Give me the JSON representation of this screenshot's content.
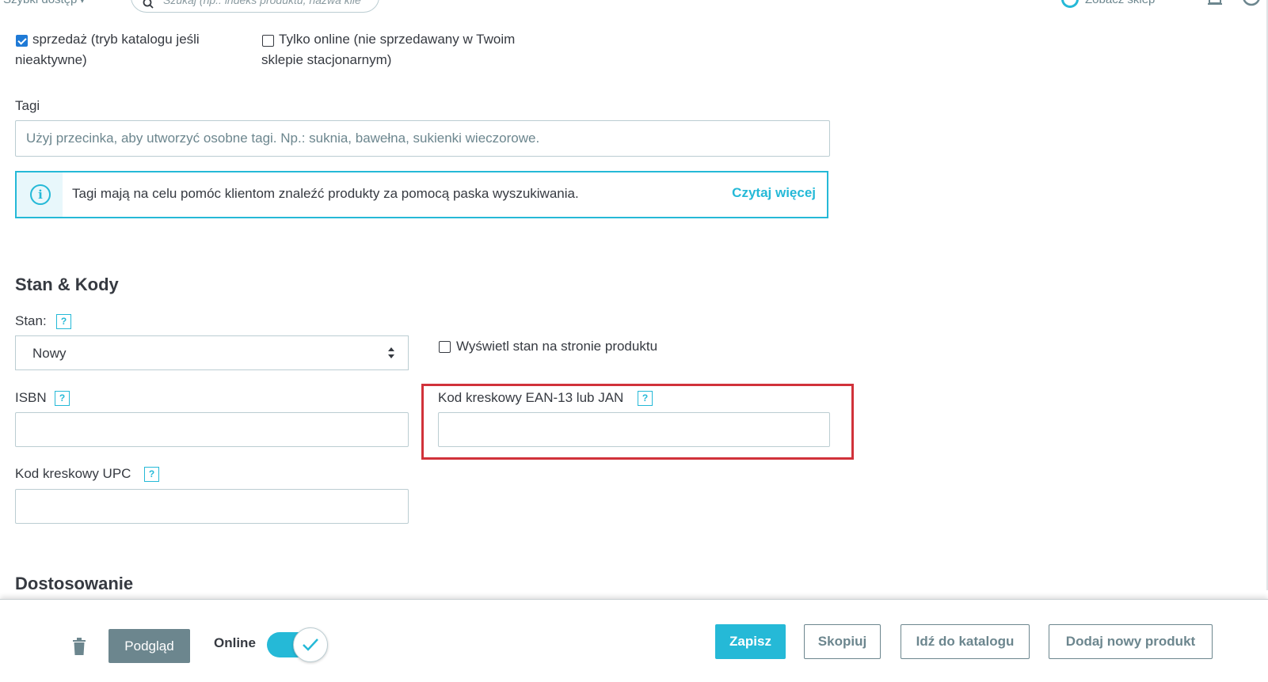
{
  "topbar": {
    "quick_access": "Szybki dostęp",
    "search_placeholder": "Szukaj (np.: indeks produktu, nazwa klie",
    "view_shop": "Zobacz sklep"
  },
  "options": {
    "sale_label_line1": "sprzedaż (tryb katalogu jeśli",
    "sale_label_line2": "nieaktywne)",
    "sale_checked": true,
    "online_only_line1": "Tylko online (nie sprzedawany w Twoim",
    "online_only_line2": "sklepie stacjonarnym)",
    "online_only_checked": false
  },
  "tags": {
    "label": "Tagi",
    "placeholder": "Użyj przecinka, aby utworzyć osobne tagi. Np.: suknia, bawełna, sukienki wieczorowe.",
    "info_text": "Tagi mają na celu pomóc klientom znaleźć produkty za pomocą paska wyszukiwania.",
    "info_link": "Czytaj więcej"
  },
  "stock_codes": {
    "title": "Stan & Kody",
    "condition_label": "Stan:",
    "condition_value": "Nowy",
    "show_condition_label": "Wyświetl stan na stronie produktu",
    "show_condition_checked": false,
    "isbn_label": "ISBN",
    "isbn_value": "",
    "ean_label": "Kod kreskowy EAN-13 lub JAN",
    "ean_value": "",
    "upc_label": "Kod kreskowy UPC",
    "upc_value": "",
    "help_glyph": "?"
  },
  "customization": {
    "title": "Dostosowanie"
  },
  "footer": {
    "preview": "Podgląd",
    "online_label": "Online",
    "online_enabled": true,
    "save": "Zapisz",
    "duplicate": "Skopiuj",
    "go_to_catalog": "Idź do katalogu",
    "add_new_product": "Dodaj nowy produkt"
  },
  "colors": {
    "accent": "#25b9d7",
    "highlight": "#d1323a",
    "secondary": "#6c868e"
  }
}
